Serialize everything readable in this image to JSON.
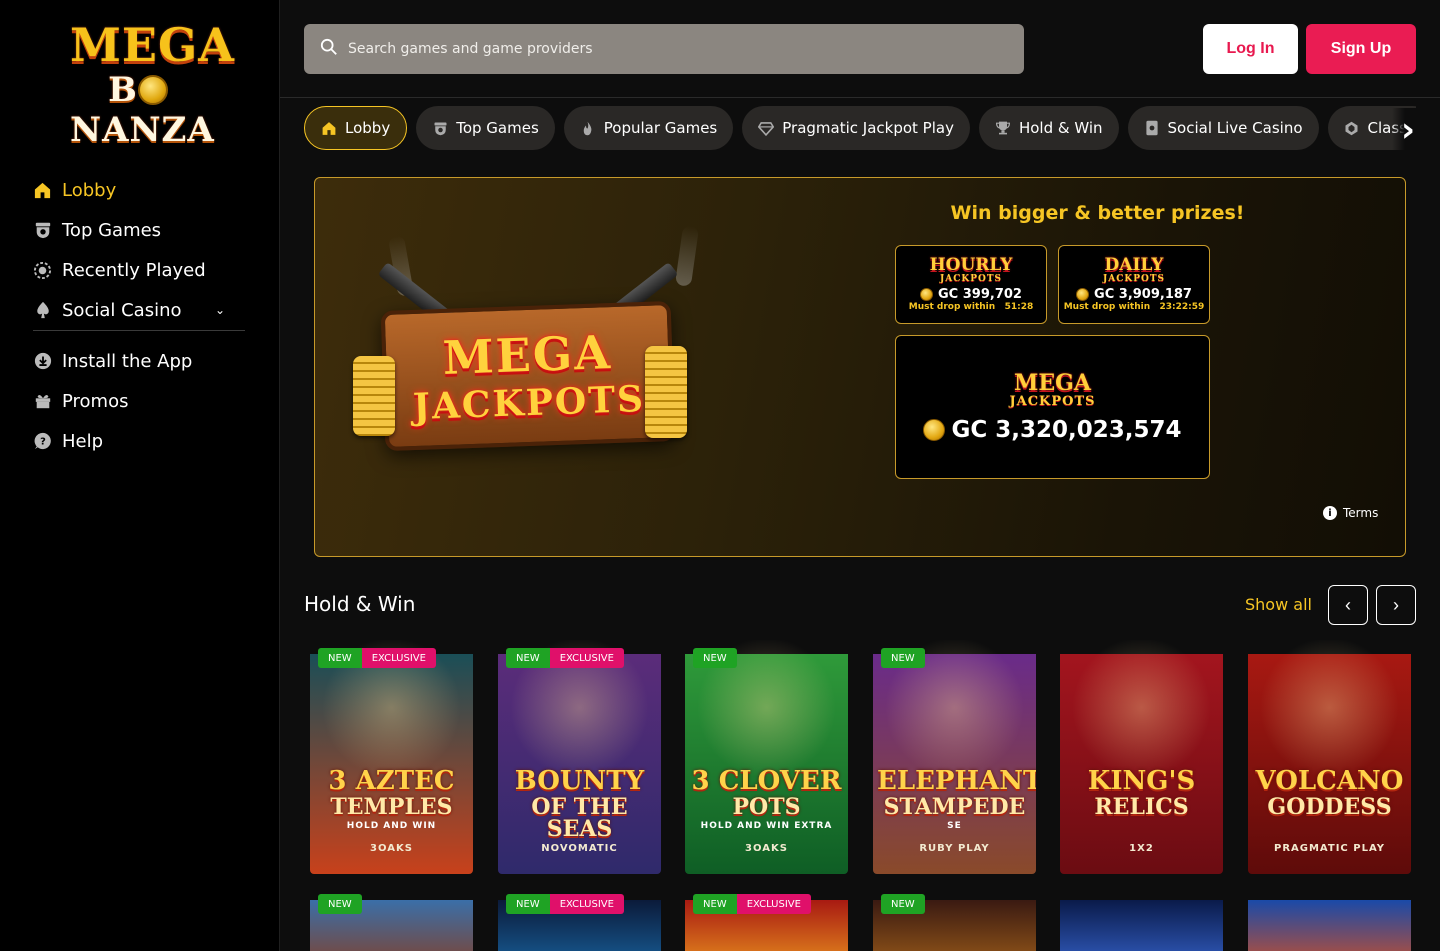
{
  "brand": {
    "line1": "MEGA",
    "line2a": "B",
    "line2b": "NANZA"
  },
  "search": {
    "placeholder": "Search games and game providers"
  },
  "auth": {
    "login": "Log In",
    "signup": "Sign Up"
  },
  "sidebar": {
    "items": [
      {
        "label": "Lobby",
        "icon": "home-icon",
        "active": true
      },
      {
        "label": "Top Games",
        "icon": "trophy-badge-icon"
      },
      {
        "label": "Recently Played",
        "icon": "history-icon"
      },
      {
        "label": "Social Casino",
        "icon": "spade-icon",
        "expandable": true
      }
    ],
    "secondary": [
      {
        "label": "Install the App",
        "icon": "download-icon"
      },
      {
        "label": "Promos",
        "icon": "gift-icon"
      },
      {
        "label": "Help",
        "icon": "help-icon"
      }
    ]
  },
  "categories": [
    {
      "label": "Lobby",
      "icon": "home-icon",
      "active": true
    },
    {
      "label": "Top Games",
      "icon": "trophy-badge-icon"
    },
    {
      "label": "Popular Games",
      "icon": "flame-icon"
    },
    {
      "label": "Pragmatic Jackpot Play",
      "icon": "diamond-icon"
    },
    {
      "label": "Hold & Win",
      "icon": "trophy-icon"
    },
    {
      "label": "Social Live Casino",
      "icon": "live-cards-icon"
    },
    {
      "label": "Classic",
      "icon": "gem-icon"
    }
  ],
  "jackpot": {
    "sign_line1": "MEGA",
    "sign_line2": "JACKPOTS",
    "headline": "Win bigger & better prizes!",
    "hourly": {
      "title": "HOURLY",
      "sub": "JACKPOTS",
      "amount": "GC 399,702",
      "drop_label": "Must drop within",
      "drop_time": "51:28"
    },
    "daily": {
      "title": "DAILY",
      "sub": "JACKPOTS",
      "amount": "GC 3,909,187",
      "drop_label": "Must drop within",
      "drop_time": "23:22:59"
    },
    "mega": {
      "title": "MEGA",
      "sub": "JACKPOTS",
      "amount": "GC 3,320,023,574"
    },
    "terms": "Terms"
  },
  "section": {
    "title": "Hold & Win",
    "show_all": "Show all",
    "prev": "‹",
    "next": "›",
    "games": [
      {
        "title1": "3 AZTEC",
        "title2": "TEMPLES",
        "sub": "HOLD AND WIN",
        "provider": "3OAKS",
        "badges": [
          "NEW",
          "EXCLUSIVE"
        ],
        "colors": [
          "#1a4e57",
          "#c8411b"
        ]
      },
      {
        "title1": "BOUNTY",
        "title2": "OF THE SEAS",
        "sub": "",
        "provider": "NOVOMATIC",
        "badges": [
          "NEW",
          "EXCLUSIVE"
        ],
        "colors": [
          "#5b2c7a",
          "#2f2a6b"
        ]
      },
      {
        "title1": "3 CLOVER",
        "title2": "POTS",
        "sub": "HOLD AND WIN EXTRA",
        "provider": "3OAKS",
        "badges": [
          "NEW"
        ],
        "colors": [
          "#2f9a3a",
          "#0f5e25"
        ]
      },
      {
        "title1": "ELEPHANT",
        "title2": "STAMPEDE",
        "sub": "SE",
        "provider": "RUBY PLAY",
        "badges": [
          "NEW"
        ],
        "colors": [
          "#6a2b8a",
          "#8a4a2a"
        ]
      },
      {
        "title1": "KING'S",
        "title2": "RELICS",
        "sub": "",
        "provider": "1X2",
        "badges": [],
        "colors": [
          "#a3151e",
          "#6b0c12"
        ]
      },
      {
        "title1": "VOLCANO",
        "title2": "GODDESS",
        "sub": "",
        "provider": "PRAGMATIC PLAY",
        "badges": [],
        "colors": [
          "#a81912",
          "#5e0b0a"
        ]
      }
    ],
    "row2": [
      {
        "badges": [
          "NEW"
        ],
        "colors": [
          "#3a6fa8",
          "#8a3a1a"
        ]
      },
      {
        "badges": [
          "NEW",
          "EXCLUSIVE"
        ],
        "colors": [
          "#0b1a3a",
          "#1a6aa8"
        ]
      },
      {
        "badges": [
          "NEW",
          "EXCLUSIVE"
        ],
        "colors": [
          "#a81a12",
          "#f0a020"
        ]
      },
      {
        "badges": [
          "NEW"
        ],
        "colors": [
          "#3a1a12",
          "#a8641a"
        ]
      },
      {
        "badges": [],
        "colors": [
          "#0a1a4a",
          "#3a6ad8"
        ]
      },
      {
        "badges": [],
        "colors": [
          "#1a4aa8",
          "#e0501a"
        ]
      }
    ]
  },
  "colors": {
    "accent": "#f6c524",
    "brand_pink": "#ea1c53",
    "badge_new": "#1fa324",
    "badge_exclusive": "#e0106a"
  }
}
